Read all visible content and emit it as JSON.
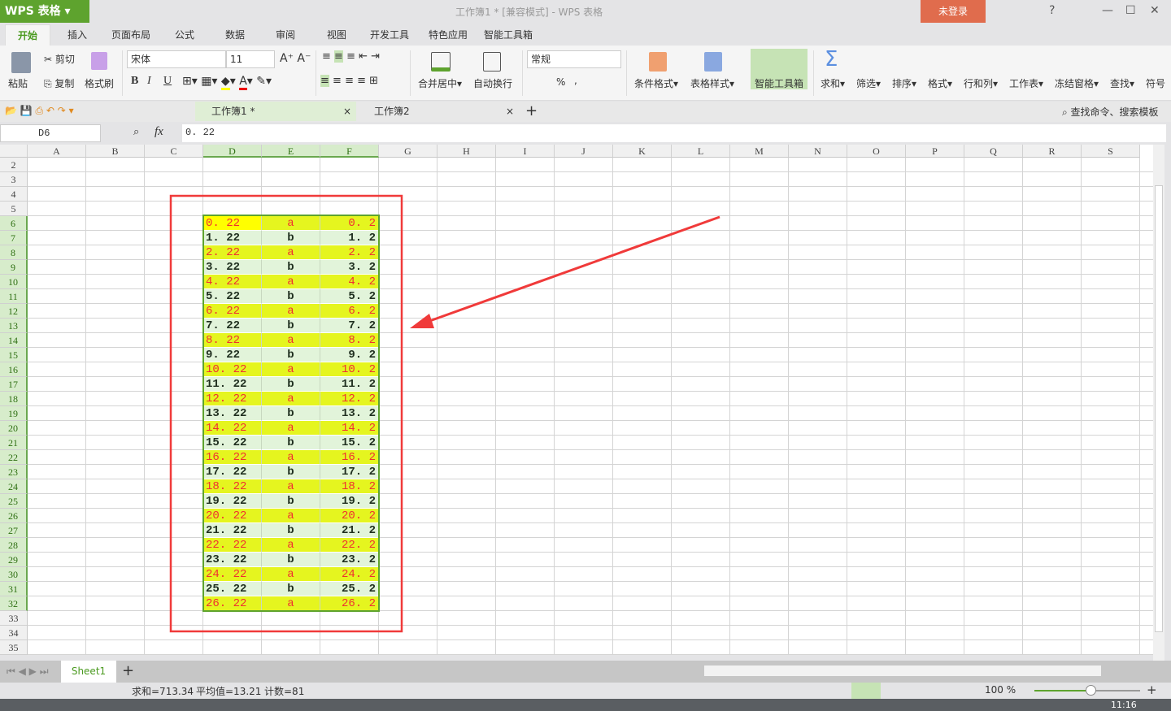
{
  "app": {
    "logo": "WPS 表格",
    "title": "工作簿1 * [兼容模式] - WPS 表格",
    "login": "未登录",
    "help": "?",
    "min": "—",
    "max": "☐",
    "close": "✕"
  },
  "menu": [
    "开始",
    "插入",
    "页面布局",
    "公式",
    "数据",
    "审阅",
    "视图",
    "开发工具",
    "特色应用",
    "智能工具箱"
  ],
  "ribbon": {
    "paste": "粘贴",
    "cut": "剪切",
    "copy": "复制",
    "format_painter": "格式刷",
    "font": "宋体",
    "size": "11",
    "bold": "B",
    "italic": "I",
    "underline": "U",
    "merge": "合并居中",
    "wrap": "自动换行",
    "number_format": "常规",
    "percent": "%",
    "comma": ",",
    "cond_format": "条件格式",
    "table_style": "表格样式",
    "smart_toolbox": "智能工具箱",
    "sum": "求和",
    "filter": "筛选",
    "sort": "排序",
    "format": "格式",
    "rowcol": "行和列",
    "worksheet": "工作表",
    "freeze": "冻结窗格",
    "find": "查找",
    "symbol": "符号"
  },
  "doctabs": [
    {
      "label": "工作簿1 *"
    },
    {
      "label": "工作簿2"
    }
  ],
  "search_cmd": "查找命令、搜索模板",
  "formula": {
    "namebox": "D6",
    "fx": "fx",
    "value": "0. 22"
  },
  "columns": [
    "A",
    "B",
    "C",
    "D",
    "E",
    "F",
    "G",
    "H",
    "I",
    "J",
    "K",
    "L",
    "M",
    "N",
    "O",
    "P",
    "Q",
    "R",
    "S"
  ],
  "rows": [
    "2",
    "3",
    "4",
    "5",
    "6",
    "7",
    "8",
    "9",
    "10",
    "11",
    "12",
    "13",
    "14",
    "15",
    "16",
    "17",
    "18",
    "19",
    "20",
    "21",
    "22",
    "23",
    "24",
    "25",
    "26",
    "27",
    "28",
    "29",
    "30",
    "31",
    "32",
    "33",
    "34",
    "35"
  ],
  "cells": {
    "D": [
      "0. 22",
      "1. 22",
      "2. 22",
      "3. 22",
      "4. 22",
      "5. 22",
      "6. 22",
      "7. 22",
      "8. 22",
      "9. 22",
      "10. 22",
      "11. 22",
      "12. 22",
      "13. 22",
      "14. 22",
      "15. 22",
      "16. 22",
      "17. 22",
      "18. 22",
      "19. 22",
      "20. 22",
      "21. 22",
      "22. 22",
      "23. 22",
      "24. 22",
      "25. 22",
      "26. 22"
    ],
    "E": [
      "a",
      "b",
      "a",
      "b",
      "a",
      "b",
      "a",
      "b",
      "a",
      "b",
      "a",
      "b",
      "a",
      "b",
      "a",
      "b",
      "a",
      "b",
      "a",
      "b",
      "a",
      "b",
      "a",
      "b",
      "a",
      "b",
      "a"
    ],
    "F": [
      "0. 2",
      "1. 2",
      "2. 2",
      "3. 2",
      "4. 2",
      "5. 2",
      "6. 2",
      "7. 2",
      "8. 2",
      "9. 2",
      "10. 2",
      "11. 2",
      "12. 2",
      "13. 2",
      "14. 2",
      "15. 2",
      "16. 2",
      "17. 2",
      "18. 2",
      "19. 2",
      "20. 2",
      "21. 2",
      "22. 2",
      "23. 2",
      "24. 2",
      "25. 2",
      "26. 2"
    ]
  },
  "sheets": [
    "Sheet1"
  ],
  "status": {
    "sum": "求和=713.34",
    "avg": "平均值=13.21",
    "count": "计数=81",
    "zoom": "100 %",
    "zoom_percent": 100
  },
  "clock": "11:16",
  "colors": {
    "accent": "#5ea32e",
    "annotation": "#f03a3a",
    "highlight": "#e5f51f"
  }
}
